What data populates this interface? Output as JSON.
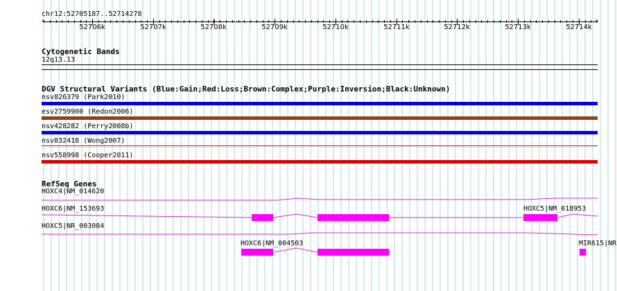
{
  "ruler": {
    "location": "chr12:52705187..52714278",
    "ticks": [
      "52706k",
      "52707k",
      "52708k",
      "52709k",
      "52710k",
      "52711k",
      "52712k",
      "52713k",
      "52714k"
    ]
  },
  "tracks": {
    "cytoband": {
      "title": "Cytogenetic Bands",
      "band": "12q13.13"
    },
    "dgv": {
      "title": "DGV Structural Variants (Blue:Gain;Red:Loss;Brown:Complex;Purple:Inversion;Black:Unknown)",
      "variants": [
        {
          "label": "nsv826379 (Park2010)",
          "color": "#0000dd"
        },
        {
          "label": "esv2759900 (Redon2006)",
          "color": "#8b4513"
        },
        {
          "label": "nsv428282 (Perry2008b)",
          "color": "#0000dd"
        },
        {
          "label": "nsv832418 (Wong2007)",
          "color": "#dd0000"
        },
        {
          "label": "nsv558998 (Cooper2011)",
          "color": "#dd0000"
        }
      ]
    },
    "refseq": {
      "title": "RefSeq Genes",
      "genes": [
        {
          "label": "HOXC4|NM_014620"
        },
        {
          "label": "HOXC6|NM_153693"
        },
        {
          "label": "HOXC5|NM_018953"
        },
        {
          "label": "HOXC5|NR_003084"
        },
        {
          "label": "HOXC6|NM_004503"
        },
        {
          "label": "MIR615|NR"
        }
      ],
      "color": "#ff00ff",
      "intron_color": "#cc33cc"
    }
  },
  "colors": {
    "grid": "#a8d8e0",
    "ruler": "#000000"
  }
}
